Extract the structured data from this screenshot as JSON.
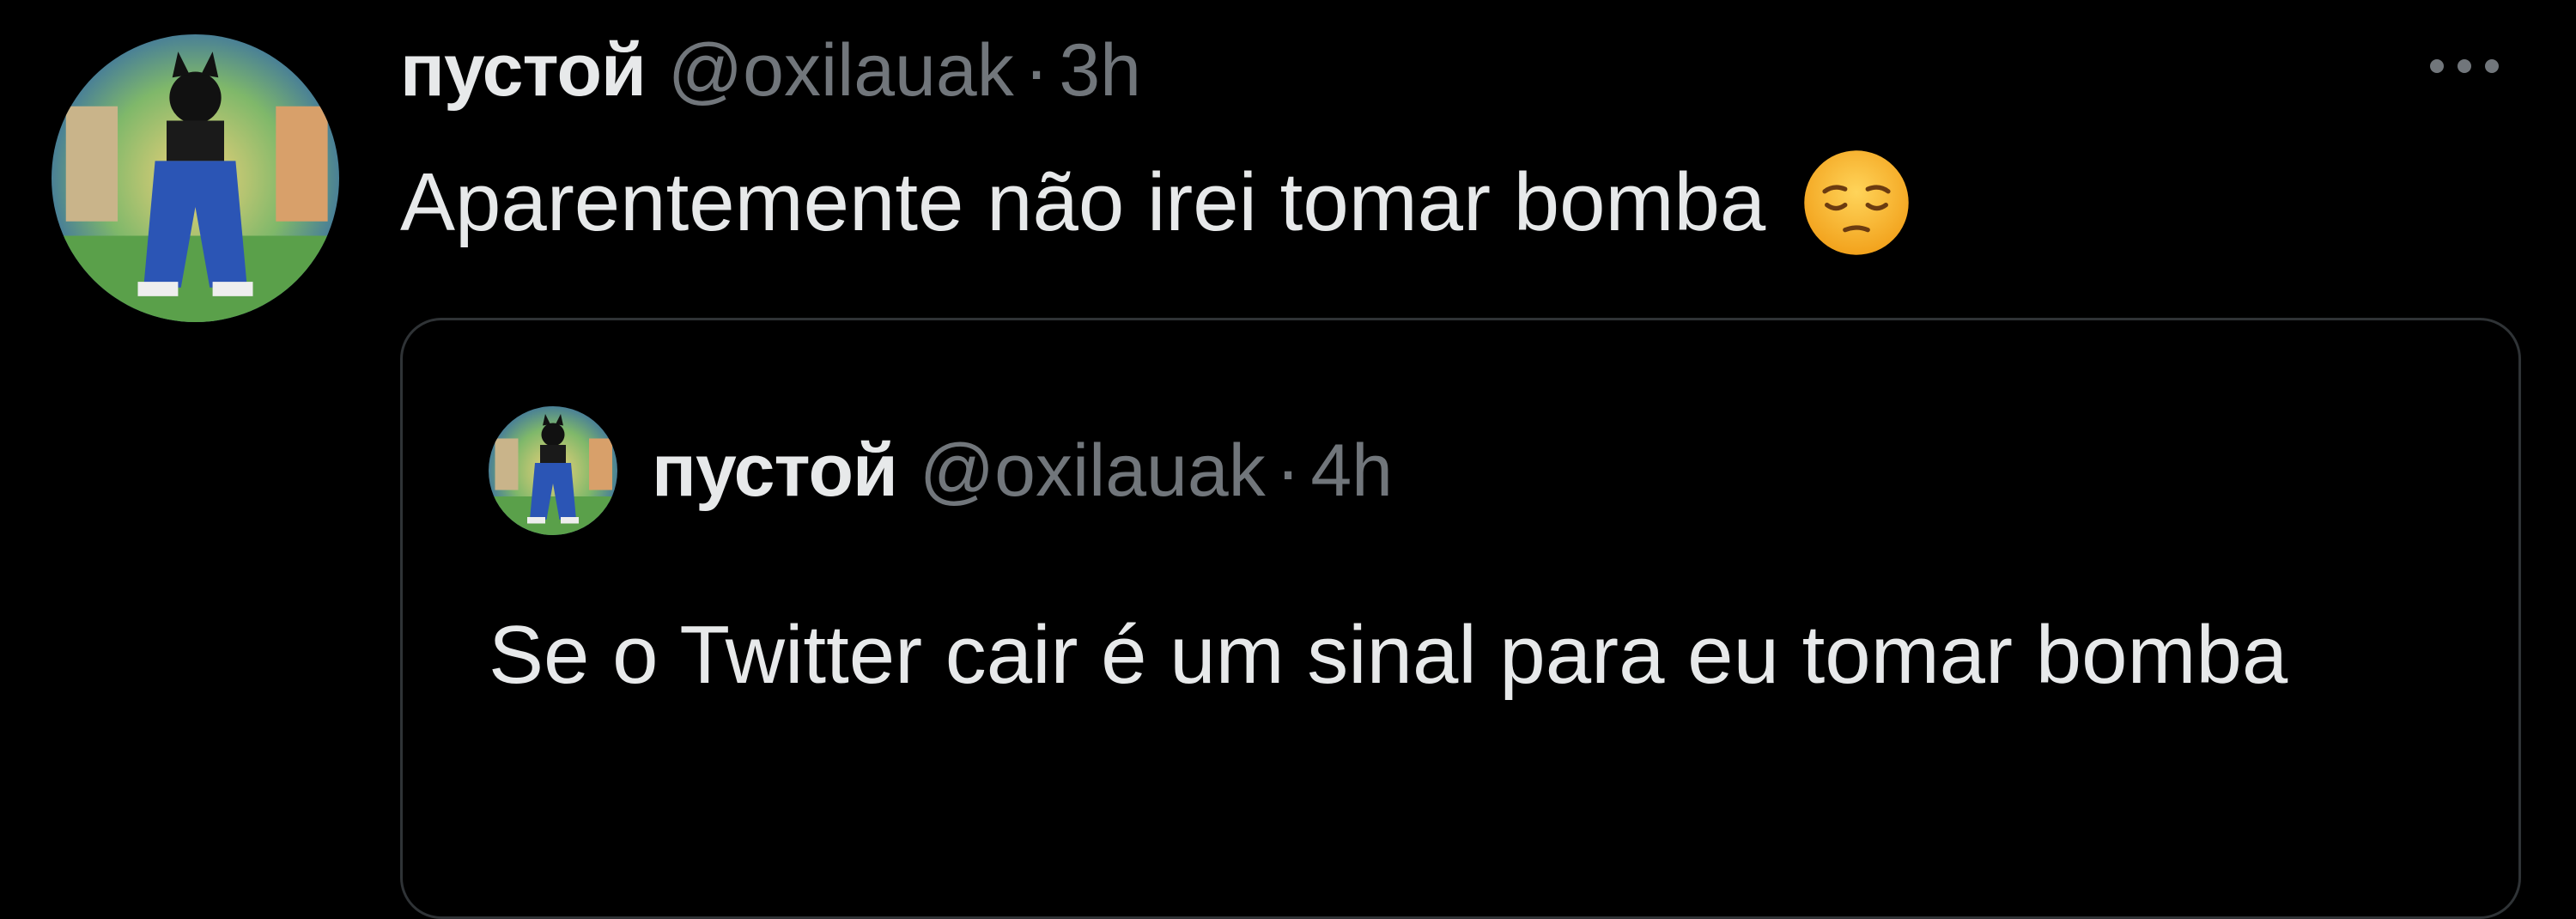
{
  "tweet": {
    "author_name": "пустой",
    "handle": "@oxilauak",
    "separator": "·",
    "time": "3h",
    "text": "Aparentemente não irei tomar bomba",
    "emoji": "pensive-face",
    "more_icon": "ellipsis-icon"
  },
  "quote": {
    "author_name": "пустой",
    "handle": "@oxilauak",
    "separator": "·",
    "time": "4h",
    "text": "Se o Twitter cair é um sinal para eu tomar bomba"
  },
  "colors": {
    "background": "#000000",
    "primary_text": "#e7e9ea",
    "secondary_text": "#71767b",
    "card_border": "#2f3336"
  }
}
